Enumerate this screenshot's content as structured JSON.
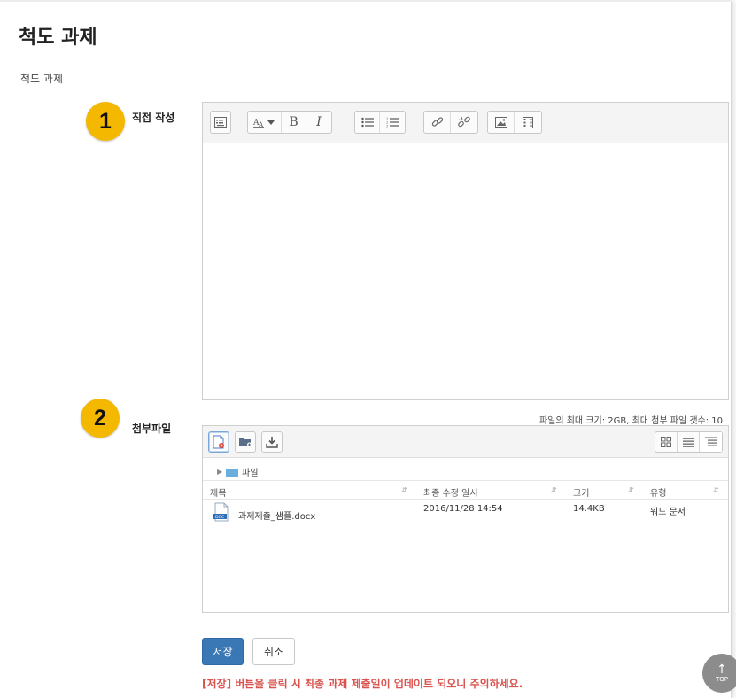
{
  "page": {
    "title": "척도 과제",
    "breadcrumb": "척도 과제"
  },
  "editor_section": {
    "badge": "1",
    "label": "직접 작성",
    "toolbar_icons": [
      "show-more-icon",
      "font-size-icon",
      "bold-icon",
      "italic-icon",
      "bullet-list-icon",
      "numbered-list-icon",
      "link-icon",
      "unlink-icon",
      "image-icon",
      "media-icon"
    ],
    "bold_glyph": "B",
    "italic_glyph": "I"
  },
  "files_section": {
    "badge": "2",
    "label": "첨부파일",
    "limits": "파일의 최대 크기: 2GB, 최대 첨부 파일 갯수: 10",
    "folder": "파일",
    "columns": [
      "제목",
      "최종 수정 일시",
      "크기",
      "유형"
    ],
    "files": [
      {
        "name": "과제제출_샘플.docx",
        "modified": "2016/11/28 14:54",
        "size": "14.4KB",
        "type": "워드 문서",
        "icon_label": "DOC"
      }
    ]
  },
  "actions": {
    "save": "저장",
    "cancel": "취소",
    "warning": "[저장] 버튼을 클릭 시 최종 과제 제출일이 업데이트 되오니 주의하세요.",
    "top": "TOP"
  },
  "colors": {
    "badge": "#f5b800",
    "save_button": "#3a78b5",
    "warning": "#d9534f",
    "top_button": "#8c8c8c"
  }
}
